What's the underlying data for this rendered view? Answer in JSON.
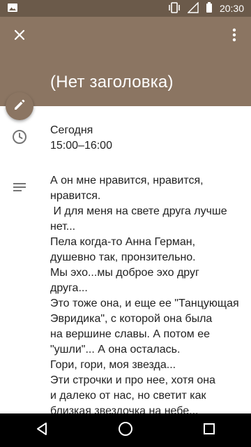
{
  "status_bar": {
    "time": "20:30",
    "icons": [
      "image-icon",
      "vibrate-icon",
      "signal-icon",
      "battery-icon"
    ]
  },
  "header": {
    "title": "(Нет заголовка)",
    "close_icon": "close-icon",
    "menu_icon": "more-vert-icon",
    "color": "#8b7562"
  },
  "fab": {
    "icon": "edit-pencil-icon"
  },
  "event": {
    "day": "Сегодня",
    "time_range": "15:00–16:00",
    "time_icon": "clock-icon",
    "description_icon": "notes-icon",
    "description_lines": [
      "А он мне нравится, нравится,",
      "нравится.",
      " И для меня на свете друга лучше",
      "нет...",
      "Пела когда-то Анна Герман,",
      "душевно так, пронзительно.",
      "Мы эхо...мы доброе эхо друг",
      "друга...",
      "Это тоже она, и еще ее \"Танцующая",
      "Эвридика\", с которой она была",
      "на вершине славы. А потом ее",
      "\"ушли\"... А она осталась.",
      "Гори, гори, моя звезда...",
      "Эти строчки и про нее, хотя она",
      "и далеко от нас, но светит как",
      "близкая звездочка на небе..."
    ]
  },
  "nav_bar": {
    "icons": [
      "back-icon",
      "home-icon",
      "recents-icon"
    ]
  }
}
